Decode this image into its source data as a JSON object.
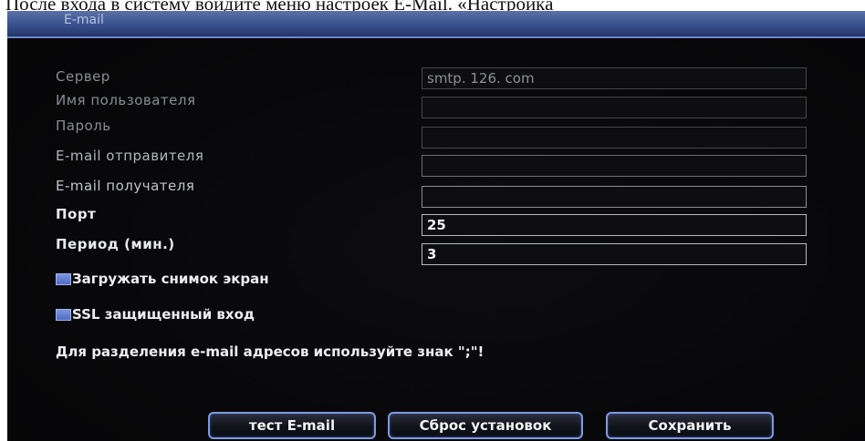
{
  "caption": "После входа в систему войдите  меню настроек E-Mail. «Настройка",
  "window": {
    "title": "E-mail"
  },
  "form": {
    "server_label": "Сервер",
    "server_value": "smtp. 126. com",
    "username_label": "Имя пользователя",
    "username_value": "",
    "password_label": "Пароль",
    "password_value": "",
    "sender_label": "E-mail отправителя",
    "sender_value": "",
    "recipient_label": "E-mail получателя",
    "recipient_value": "",
    "port_label": "Порт",
    "port_value": "25",
    "period_label": "Период (мин.)",
    "period_value": "3"
  },
  "options": {
    "snapshot_label": "Загружать снимок экран",
    "snapshot_checked": true,
    "ssl_label": "SSL защищенный вход",
    "ssl_checked": true
  },
  "note": "Для разделения e-mail адресов используйте знак \";\"!",
  "buttons": {
    "test": "тест E-mail",
    "reset": "Сброс установок",
    "save": "Сохранить"
  }
}
